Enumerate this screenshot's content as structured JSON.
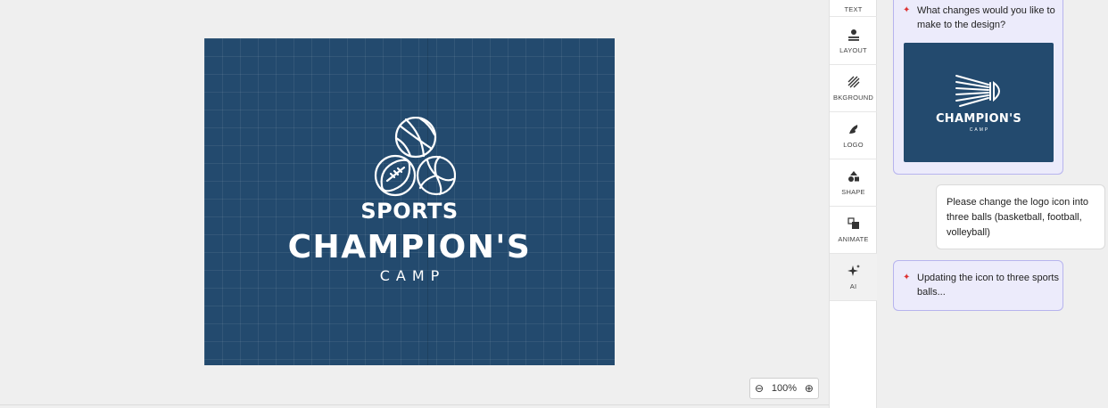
{
  "canvas": {
    "background": "#234a6e",
    "text_line1": "SPORTS",
    "text_line2": "CHAMPION'S",
    "text_line3": "CAMP",
    "logo_icons": [
      "basketball-icon",
      "football-icon",
      "volleyball-icon"
    ]
  },
  "zoom": {
    "zoom_out_glyph": "⊖",
    "level": "100%",
    "zoom_in_glyph": "⊕"
  },
  "toolbar": {
    "items": [
      {
        "label": "TEXT",
        "icon": "text-icon"
      },
      {
        "label": "LAYOUT",
        "icon": "layout-icon"
      },
      {
        "label": "BKGROUND",
        "icon": "background-icon"
      },
      {
        "label": "LOGO",
        "icon": "logo-icon"
      },
      {
        "label": "SHAPE",
        "icon": "shape-icon"
      },
      {
        "label": "ANIMATE",
        "icon": "animate-icon"
      },
      {
        "label": "AI",
        "icon": "sparkle-icon"
      }
    ]
  },
  "chat": {
    "messages": [
      {
        "role": "ai",
        "text": "What changes would you like to make to the design?"
      },
      {
        "role": "user",
        "text": "Please change the logo icon into three balls (basketball, football, volleyball)"
      },
      {
        "role": "ai",
        "text": "Updating the icon to three sports balls..."
      }
    ],
    "preview": {
      "title": "CHAMPION'S",
      "subtitle": "CAMP",
      "icon": "shuttlecock-icon"
    },
    "accent": "#d33a3a"
  }
}
